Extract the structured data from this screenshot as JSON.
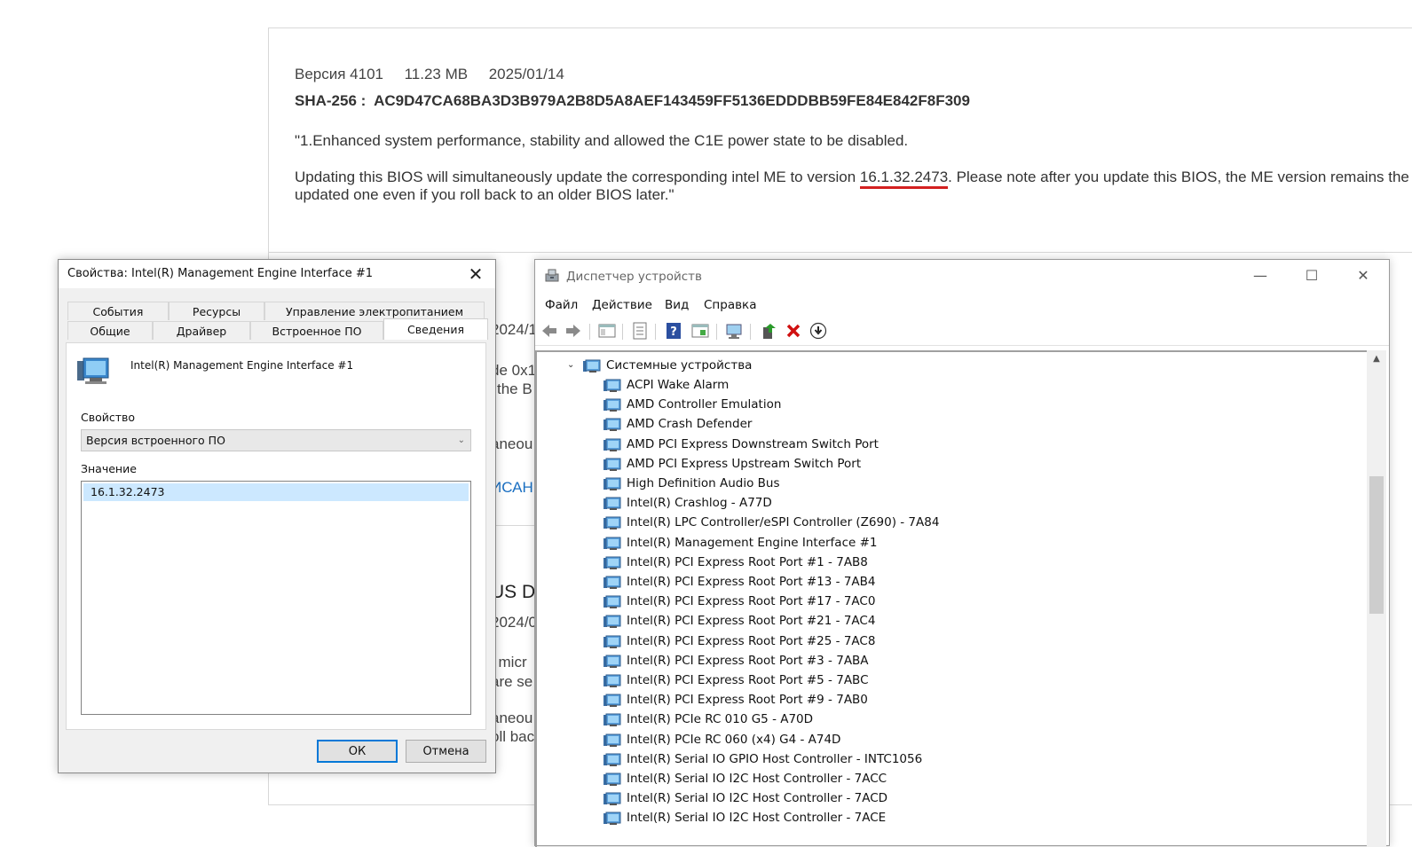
{
  "web": {
    "version_line": "Версия 4101     11.23 MB     2025/01/14",
    "sha_line": "SHA-256 :  AC9D47CA68BA3D3B979A2B8D5A8AEF143459FF5136EDDDBB59FE84E842F8F309",
    "desc1": "\"1.Enhanced system performance, stability and allowed the C1E power state to be disabled.",
    "desc2_before": "Updating this BIOS will simultaneously update the corresponding intel ME to version ",
    "me_version": "16.1.32.2473",
    "desc2_after": ". Please note after you update this BIOS, the ME version remains the updated one even if you roll back to an older BIOS later.\"",
    "fragments": [
      "2024/1",
      "de 0x1",
      "the B",
      "aneou",
      "ИСАН",
      "US D4",
      "2024/0",
      "l micr",
      "are se",
      "aneou",
      "oll bac"
    ]
  },
  "dialog": {
    "title": "Свойства: Intel(R) Management Engine Interface #1",
    "close_glyph": "✕",
    "tabs_row1": [
      "События",
      "Ресурсы",
      "Управление электропитанием"
    ],
    "tabs_row2": [
      "Общие",
      "Драйвер",
      "Встроенное ПО",
      "Сведения"
    ],
    "active_tab": "Сведения",
    "device_name": "Intel(R) Management Engine Interface #1",
    "property_label": "Свойство",
    "property_value": "Версия встроенного ПО",
    "value_label": "Значение",
    "values": [
      "16.1.32.2473"
    ],
    "ok": "ОК",
    "cancel": "Отмена"
  },
  "devmgr": {
    "title": "Диспетчер устройств",
    "menu": [
      "Файл",
      "Действие",
      "Вид",
      "Справка"
    ],
    "toolbar_icons": [
      "back-arrow-icon",
      "forward-arrow-icon",
      "show-hide-console-tree-icon",
      "properties-icon",
      "help-icon",
      "show-view-icon",
      "scan-hardware-icon",
      "update-driver-icon",
      "uninstall-device-icon",
      "disable-device-icon"
    ],
    "category": "Системные устройства",
    "devices": [
      "ACPI Wake Alarm",
      "AMD Controller Emulation",
      "AMD Crash Defender",
      "AMD PCI Express Downstream Switch Port",
      "AMD PCI Express Upstream Switch Port",
      "High Definition Audio Bus",
      "Intel(R) Crashlog - A77D",
      "Intel(R) LPC Controller/eSPI Controller (Z690) - 7A84",
      "Intel(R) Management Engine Interface #1",
      "Intel(R) PCI Express Root Port #1 - 7AB8",
      "Intel(R) PCI Express Root Port #13 - 7AB4",
      "Intel(R) PCI Express Root Port #17 - 7AC0",
      "Intel(R) PCI Express Root Port #21 - 7AC4",
      "Intel(R) PCI Express Root Port #25 - 7AC8",
      "Intel(R) PCI Express Root Port #3 - 7ABA",
      "Intel(R) PCI Express Root Port #5 - 7ABC",
      "Intel(R) PCI Express Root Port #9 - 7AB0",
      "Intel(R) PCIe RC 010 G5 - A70D",
      "Intel(R) PCIe RC 060 (x4) G4 - A74D",
      "Intel(R) Serial IO GPIO Host Controller - INTC1056",
      "Intel(R) Serial IO I2C Host Controller - 7ACC",
      "Intel(R) Serial IO I2C Host Controller - 7ACD",
      "Intel(R) Serial IO I2C Host Controller - 7ACE"
    ]
  }
}
